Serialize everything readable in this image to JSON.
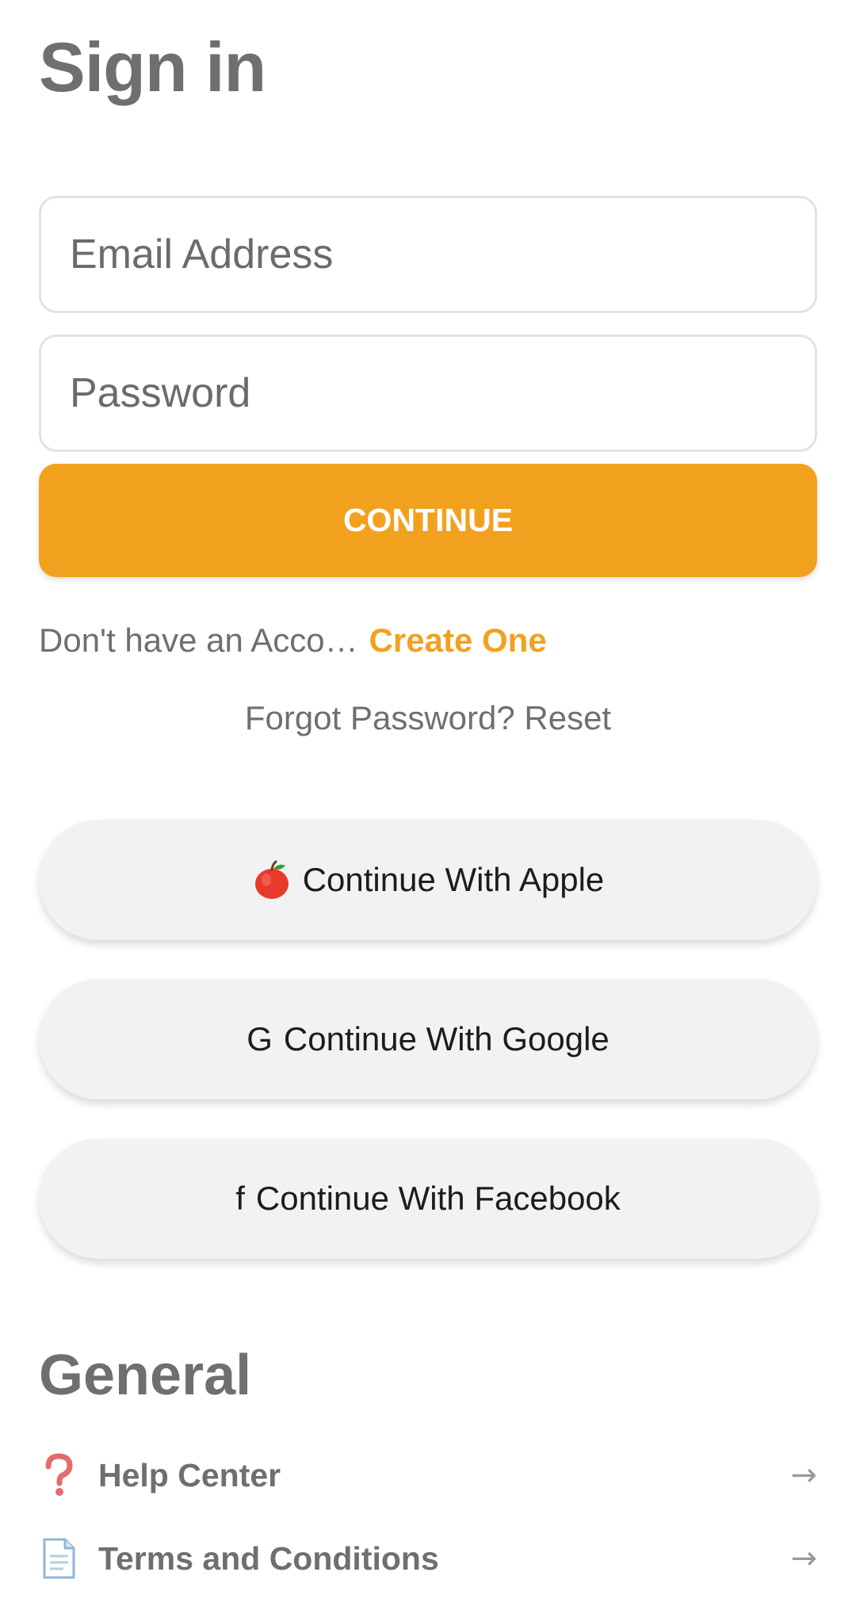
{
  "header": {
    "title": "Sign in"
  },
  "form": {
    "email_placeholder": "Email Address",
    "password_placeholder": "Password",
    "continue_label": "CONTINUE"
  },
  "account": {
    "prompt": "Don't have an Acco…",
    "create_label": "Create One"
  },
  "forgot": {
    "label": "Forgot Password? Reset"
  },
  "social": {
    "apple": {
      "icon": "apple-emoji-icon",
      "label": "Continue With Apple"
    },
    "google": {
      "icon_text": "G",
      "label": "Continue With Google"
    },
    "facebook": {
      "icon_text": "f",
      "label": "Continue With Facebook"
    }
  },
  "general": {
    "title": "General",
    "items": [
      {
        "icon": "question-mark-icon",
        "label": "Help Center",
        "arrow": "→"
      },
      {
        "icon": "document-icon",
        "label": "Terms and Conditions",
        "arrow": "→"
      }
    ]
  },
  "colors": {
    "accent": "#f2a11f",
    "text_gray": "#6f6f6f",
    "social_bg": "#f2f2f4"
  }
}
